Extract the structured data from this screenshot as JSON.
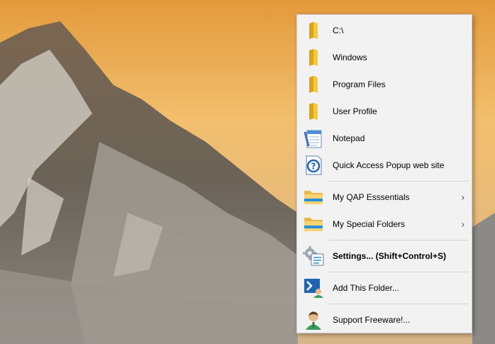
{
  "menu": {
    "items": [
      {
        "label": "C:\\",
        "icon": "folder-icon"
      },
      {
        "label": "Windows",
        "icon": "folder-icon"
      },
      {
        "label": "Program Files",
        "icon": "folder-icon"
      },
      {
        "label": "User Profile",
        "icon": "folder-icon"
      },
      {
        "label": "Notepad",
        "icon": "notepad-icon"
      },
      {
        "label": "Quick Access Popup web site",
        "icon": "help-icon"
      },
      {
        "label": "My QAP Esssentials",
        "icon": "folder-explorer-icon",
        "submenu": true
      },
      {
        "label": "My Special Folders",
        "icon": "folder-explorer-icon",
        "submenu": true
      },
      {
        "label": "Settings... (Shift+Control+S)",
        "icon": "settings-gear-icon"
      },
      {
        "label": "Add This Folder...",
        "icon": "add-folder-icon"
      },
      {
        "label": "Support Freeware!...",
        "icon": "support-user-icon"
      }
    ],
    "submenu_arrow": "›"
  },
  "colors": {
    "menu_bg": "#f2f2f2",
    "folder_yellow": "#f5c842",
    "accent_blue": "#1e64b4"
  }
}
